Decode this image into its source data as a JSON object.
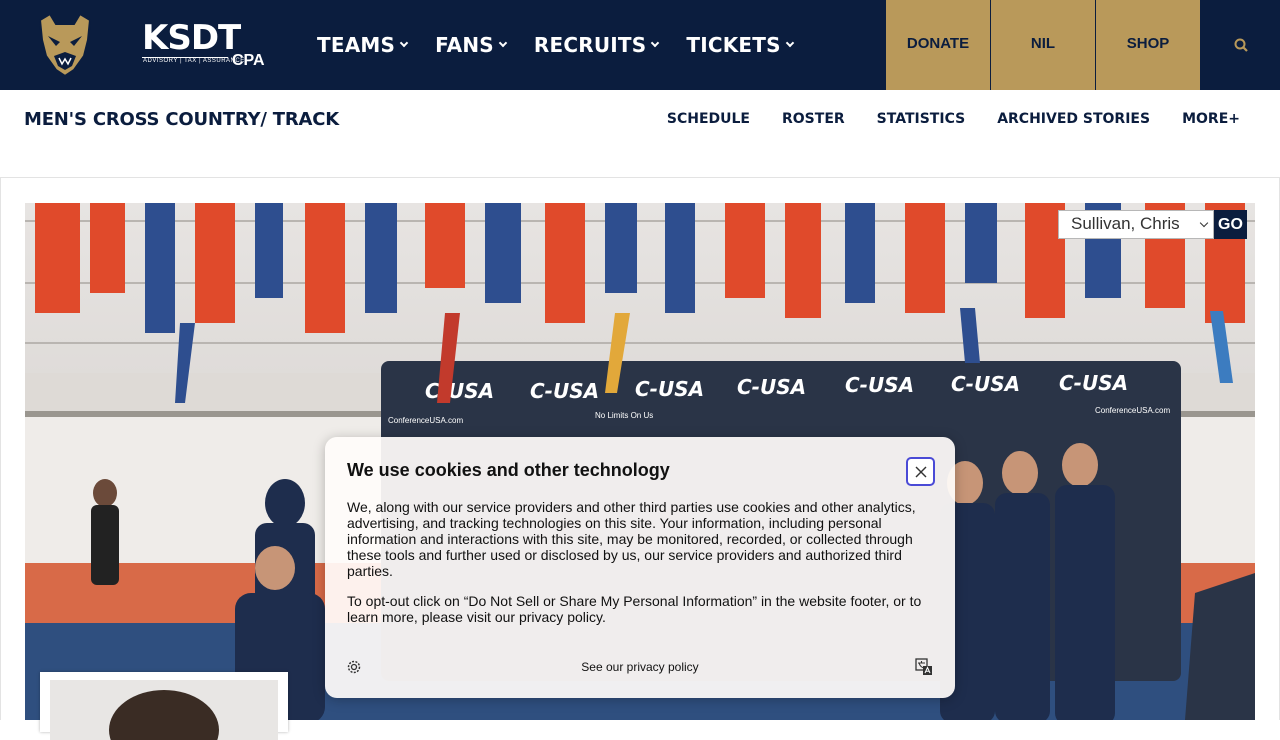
{
  "header": {
    "sponsor": {
      "name": "KSDT",
      "suffix": "CPA",
      "tagline": "ADVISORY | TAX | ASSURANCE"
    },
    "nav": [
      {
        "label": "TEAMS"
      },
      {
        "label": "FANS"
      },
      {
        "label": "RECRUITS"
      },
      {
        "label": "TICKETS"
      }
    ],
    "buttons": {
      "donate": "DONATE",
      "nil": "NIL",
      "shop": "SHOP"
    },
    "accent_gold": "#b9995a",
    "navy": "#0b1d3e"
  },
  "subnav": {
    "title": "MEN'S CROSS COUNTRY/ TRACK",
    "links": [
      {
        "label": "SCHEDULE"
      },
      {
        "label": "ROSTER"
      },
      {
        "label": "STATISTICS"
      },
      {
        "label": "ARCHIVED STORIES"
      },
      {
        "label": "MORE+"
      }
    ]
  },
  "roster_picker": {
    "selected": "Sullivan, Chris",
    "go_label": "GO"
  },
  "hero": {
    "banner_brand": "C-USA",
    "banner_url": "ConferenceUSA.com",
    "banner_slogan": "No Limits On Us"
  },
  "cookie": {
    "title": "We use cookies and other technology",
    "body1": "We, along with our service providers and other third parties use cookies and other analytics, advertising, and tracking technologies on this site. Your information, including personal information and interactions with this site, may be monitored, recorded, or collected through these tools and further used or disclosed by us, our service providers and authorized third parties.",
    "body2": "To opt-out click on “Do Not Sell or Share My Personal Information” in the website footer, or to learn more, please visit our privacy policy.",
    "privacy_link": "See our privacy policy"
  }
}
